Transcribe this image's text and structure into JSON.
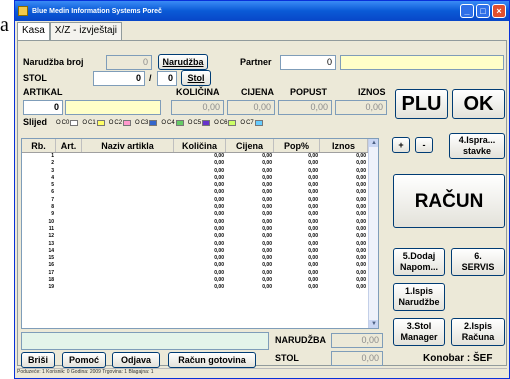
{
  "outside_letter": "a",
  "window": {
    "title": "Blue Medin Information Systems Poreč"
  },
  "tabs": [
    {
      "label": "Kasa"
    },
    {
      "label": "X/Z - izvještaji"
    }
  ],
  "form": {
    "narudzba_label": "Narudžba broj",
    "narudzba_value": "0",
    "narudzba_button": "Narudžba",
    "partner_label": "Partner",
    "partner_value": "0",
    "stol_label": "STOL",
    "stol_value": "0",
    "stol_sep": "/",
    "stol_value2": "0",
    "stol_button": "Stol",
    "artikal_label": "ARTIKAL",
    "artikal_value": "0",
    "kolicina_label": "KOLIČINA",
    "kolicina_value": "0,00",
    "cijena_label": "CIJENA",
    "cijena_value": "0,00",
    "popust_label": "POPUST",
    "popust_value": "0,00",
    "iznos_label": "IZNOS",
    "iznos_value": "0,00",
    "slijed_label": "Slijed"
  },
  "legend": [
    {
      "label": "C0",
      "color": "#ffffff"
    },
    {
      "label": "C1",
      "color": "#ffff66"
    },
    {
      "label": "C2",
      "color": "#ff99cc"
    },
    {
      "label": "C3",
      "color": "#3366cc"
    },
    {
      "label": "C4",
      "color": "#66cc66"
    },
    {
      "label": "C5",
      "color": "#6633cc"
    },
    {
      "label": "C6",
      "color": "#ccff66"
    },
    {
      "label": "C7",
      "color": "#66ccff"
    }
  ],
  "grid": {
    "headers": [
      "Rb.",
      "Art.",
      "Naziv artikla",
      "Količina",
      "Cijena",
      "Pop%",
      "Iznos"
    ],
    "row_value": "0,00",
    "rows": [
      "1",
      "2",
      "3",
      "4",
      "5",
      "6",
      "7",
      "8",
      "9",
      "10",
      "11",
      "12",
      "13",
      "14",
      "15",
      "16",
      "17",
      "18",
      "19"
    ]
  },
  "buttons": {
    "plu": "PLU",
    "ok": "OK",
    "plus": "+",
    "minus": "-",
    "ispravak": "4.Ispra...\nstavke",
    "racun": "RAČUN",
    "dodaj": "5.Dodaj\nNapom...",
    "servis": "6.\nSERVIS",
    "ispis_nar": "1.Ispis\nNarudžbe",
    "stol_manager": "3.Stol\nManager",
    "ispis_racuna": "2.Ispis\nRačuna",
    "brisi": "Briši",
    "pomoc": "Pomoć",
    "odjava": "Odjava",
    "racun_gotovina": "Račun gotovina"
  },
  "totals": {
    "narudzba_label": "NARUDŽBA",
    "narudzba_value": "0,00",
    "stol_label": "STOL",
    "stol_value": "0,00"
  },
  "konobar": "Konobar : ŠEF",
  "status_text": "Poduzeće: 1 Korisnik: 0 Godina: 2009 Trgovina: 1 Blagajna: 1"
}
